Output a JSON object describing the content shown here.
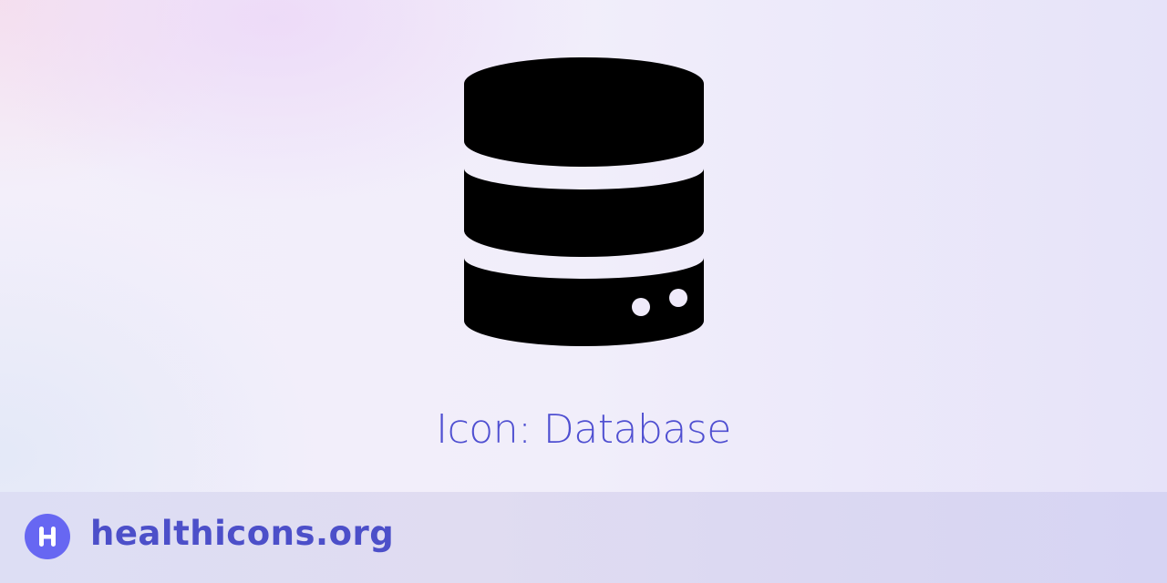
{
  "icon": {
    "name": "database-icon"
  },
  "title": "Icon: Database",
  "footer": {
    "site": "healthicons.org",
    "logo_letter": "H"
  },
  "colors": {
    "accent": "#4f4fd1",
    "logo_bg": "#6767f2",
    "icon": "#000000"
  }
}
